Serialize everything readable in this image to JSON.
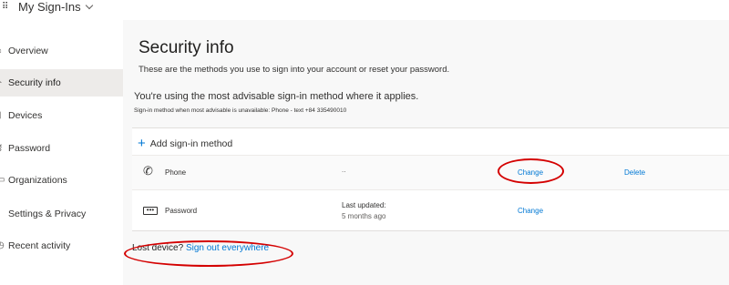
{
  "header": {
    "app_title": "My Sign-Ins"
  },
  "sidebar": {
    "items": [
      {
        "label": "Overview",
        "active": false
      },
      {
        "label": "Security info",
        "active": true
      },
      {
        "label": "Devices",
        "active": false
      },
      {
        "label": "Password",
        "active": false
      },
      {
        "label": "Organizations",
        "active": false
      },
      {
        "label": "Settings & Privacy",
        "active": false
      },
      {
        "label": "Recent activity",
        "active": false
      }
    ]
  },
  "main": {
    "title": "Security info",
    "subtitle": "These are the methods you use to sign into your account or reset your password.",
    "advisable": "You're using the most advisable sign-in method where it applies.",
    "advisable_note": "Sign-in method when most advisable is unavailable: Phone - text +84 335490010",
    "add_method_label": "Add sign-in method",
    "methods": [
      {
        "name": "Phone",
        "detail": "..",
        "change_label": "Change",
        "delete_label": "Delete"
      },
      {
        "name": "Password",
        "detail_line1": "Last updated:",
        "detail_line2": "5 months ago",
        "change_label": "Change"
      }
    ],
    "lost_device_label": "Lost device?",
    "sign_out_label": "Sign out everywhere"
  },
  "colors": {
    "accent": "#0078d4",
    "annotation": "#d40000"
  },
  "icons": [
    "app-launcher-icon",
    "chevron-down-icon",
    "plus-icon",
    "phone-icon",
    "password-dots-icon"
  ]
}
